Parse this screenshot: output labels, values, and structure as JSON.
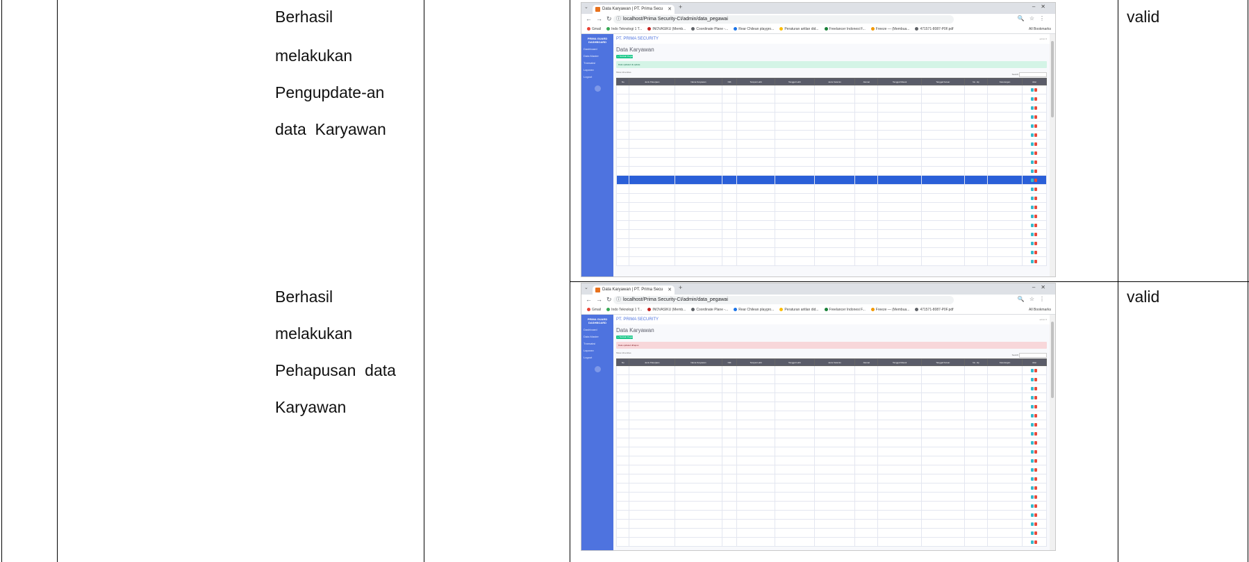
{
  "rows": [
    {
      "description_lines": [
        "Berhasil",
        "melakukan",
        "Pengupdate-an",
        "data  Karyawan"
      ],
      "status": "valid",
      "screenshot": {
        "tab_title": "Data Karyawan | PT. Prima Secu",
        "url": "localhost/Prima Security-CI/admin/data_pegawai",
        "bookmarks": [
          "Gmail",
          "Indo Teknologi 1 T...",
          "INOVASIKU (Memb...",
          "Coordinate Plane -...",
          "Rear Chilean playgro...",
          "Peraturan aritlan did...",
          "Freelancer Indonesi F...",
          "Freeze — (Membua...",
          "471571-8087-P0F.pdf"
        ],
        "bookmarks_right": "All Bookmarks",
        "app_title": "PT. PRIMA SECURITY",
        "sidebar_brand": "PRIMA GUARD DASHBOARD",
        "sidebar_items": [
          "Dashboard",
          "Data Master",
          "Transaksi",
          "Laporan",
          "Logout"
        ],
        "page_title": "Data Karyawan",
        "add_button": "+ Tambah Pegawai",
        "alert": "Data updated  di-update",
        "alert_type": "green",
        "show_entries": "Show 10 entries",
        "search_label": "Search:",
        "columns": [
          "No",
          "Jenis Pekerjaan",
          "Nama Karyawan",
          "NIK",
          "Tempat Lahir",
          "Tanggal Lahir",
          "Jenis Kelamin",
          "Alamat",
          "Tanggal Masuk",
          "Tanggal Keluar",
          "No. Hp",
          "Keterangan",
          "Aksi"
        ],
        "row_count": 20,
        "selected_row": 10
      }
    },
    {
      "description_lines": [
        "Berhasil",
        "melakukan",
        "Pehapusan  data",
        "Karyawan"
      ],
      "status": "valid",
      "screenshot": {
        "tab_title": "Data Karyawan | PT. Prima Secu",
        "url": "localhost/Prima Security-CI/admin/data_pegawai",
        "bookmarks": [
          "Gmail",
          "Indo Teknologi 1 T...",
          "INOVASIKU (Memb...",
          "Coordinate Plane -...",
          "Rear Chilean playgro...",
          "Peraturan aritlan did...",
          "Freelancer Indonesi F...",
          "Freeze — (Membua...",
          "471571-8087-P0F.pdf"
        ],
        "bookmarks_right": "All Bookmarks",
        "app_title": "PT. PRIMA SECURITY",
        "sidebar_brand": "PRIMA GUARD DASHBOARD",
        "sidebar_items": [
          "Dashboard",
          "Data Master",
          "Transaksi",
          "Laporan",
          "Logout"
        ],
        "page_title": "Data Karyawan",
        "add_button": "+ Tambah Pegawai",
        "alert": "Data updated  dihapus",
        "alert_type": "red",
        "show_entries": "Show 10 entries",
        "search_label": "Search:",
        "columns": [
          "No",
          "Jenis Pekerjaan",
          "Nama Karyawan",
          "NIK",
          "Tempat Lahir",
          "Tanggal Lahir",
          "Jenis Kelamin",
          "Alamat",
          "Tanggal Masuk",
          "Tanggal Keluar",
          "No. Hp",
          "Keterangan",
          "Aksi"
        ],
        "row_count": 20,
        "selected_row": -1
      }
    }
  ]
}
